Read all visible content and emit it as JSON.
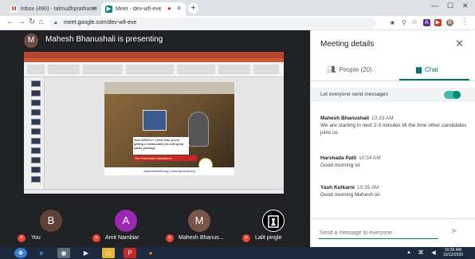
{
  "browser": {
    "tabs": [
      {
        "label": "Inbox (490) - talmudhprathame",
        "favicon": "gmail-icon",
        "color": "#d93025"
      },
      {
        "label": "Meet - dev-wfi-eve",
        "favicon": "meet-icon",
        "color": "#00897b"
      }
    ],
    "url": "meet.google.com/dev-wfi-eve"
  },
  "stage": {
    "presenter_initial": "M",
    "presenter_text": "Mahesh Bhanushali is presenting",
    "slide": {
      "text_block": "Now WEEKLY, Hindi Way you're getting a measurable job with great salary package",
      "banner": "Get Placement Assistance",
      "footer": "www.webniira.org | www.spmcsit.org"
    }
  },
  "participants": [
    {
      "initial": "B",
      "name": "You",
      "color": "#5d4037"
    },
    {
      "initial": "A",
      "name": "Amit Nambiar",
      "color": "#9c27b0"
    },
    {
      "initial": "M",
      "name": "Mahesh Bhanus...",
      "color": "#795548"
    },
    {
      "initial": "",
      "name": "Lalit pingle",
      "color": "#000000"
    }
  ],
  "panel": {
    "title": "Meeting details",
    "people_tab": "People (20)",
    "chat_tab": "Chat",
    "setting_label": "Let everyone send messages",
    "messages": [
      {
        "sender": "Mahesh Bhanushali",
        "time": "10:33 AM",
        "text": "We are starting in next 2-3 minutes till the time other candidates joins us"
      },
      {
        "sender": "Harshada Patil",
        "time": "10:34 AM",
        "text": "Good morning sir"
      },
      {
        "sender": "Yash Kulkarni",
        "time": "10:35 AM",
        "text": "Good morning Mahesh sir"
      }
    ],
    "compose_placeholder": "Send a message to everyone"
  },
  "taskbar": {
    "time": "10:35 AM",
    "date": "10/12/2020"
  },
  "colors": {
    "accent": "#00796b",
    "stage_bg": "#202124",
    "mic_off": "#ea4335"
  }
}
